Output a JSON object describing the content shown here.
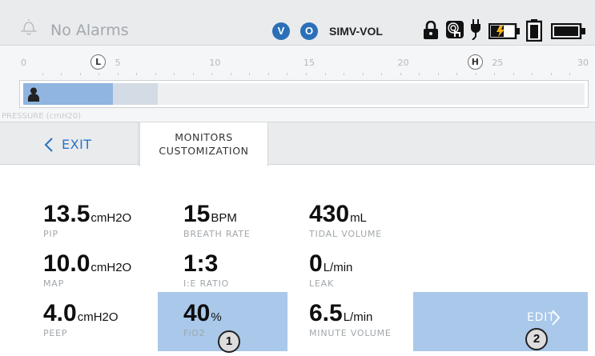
{
  "status_bar": {
    "alarm_text": "No Alarms",
    "mode_badge_v": "V",
    "mode_badge_o": "O",
    "mode": "SIMV-VOL",
    "icons": [
      "bell-icon",
      "lock-icon",
      "touch-lock-icon",
      "ac-power-icon",
      "battery-charging-icon",
      "battery-full-icon",
      "external-battery-icon"
    ],
    "battery_levels": {
      "charging": 0.55,
      "internal": 1.0,
      "external": 1.0
    }
  },
  "pressure_scale": {
    "ticks": [
      "0",
      "5",
      "10",
      "15",
      "20",
      "25",
      "30"
    ],
    "low_marker": "L",
    "high_marker": "H",
    "low_limit": 4,
    "high_limit": 24,
    "min": 0,
    "max": 30,
    "current_value": 4.8,
    "peak_value": 7.2,
    "label": "PRESSURE (cmH20)",
    "colors": {
      "fill": "#8fb5e0",
      "peak": "#d3dce5"
    }
  },
  "tabs": {
    "exit_label": "EXIT",
    "active_label": "MONITORS\nCUSTOMIZATION"
  },
  "monitors": [
    {
      "value": "13.5",
      "unit": "cmH2O",
      "name": "PIP"
    },
    {
      "value": "15",
      "unit": "BPM",
      "name": "BREATH RATE"
    },
    {
      "value": "430",
      "unit": "mL",
      "name": "TIDAL VOLUME"
    },
    {
      "value": "10.0",
      "unit": "cmH2O",
      "name": "MAP"
    },
    {
      "value": "1:3",
      "unit": "",
      "name": "I:E RATIO"
    },
    {
      "value": "0",
      "unit": "L/min",
      "name": "LEAK"
    },
    {
      "value": "4.0",
      "unit": "cmH2O",
      "name": "PEEP"
    },
    {
      "value": "40",
      "unit": "%",
      "name": "FiO2"
    },
    {
      "value": "6.5",
      "unit": "L/min",
      "name": "MINUTE VOLUME"
    }
  ],
  "edit_button": {
    "label": "EDIT"
  },
  "callouts": [
    "1",
    "2"
  ],
  "colors": {
    "accent": "#2a73c4",
    "highlight": "#a9c8ea",
    "badge": "#2a6fb8"
  }
}
